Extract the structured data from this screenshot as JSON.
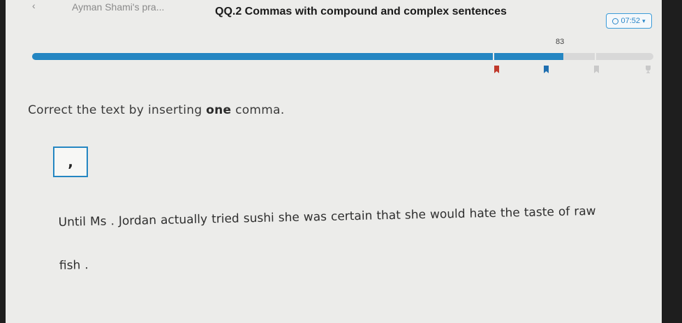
{
  "header": {
    "breadcrumb": "Ayman Shami's pra...",
    "skill_title": "QQ.2 Commas with compound and complex sentences",
    "timer": "07:52"
  },
  "progress": {
    "score_label": "83",
    "fraction": 0.855
  },
  "question": {
    "prompt_before": "Correct the text by inserting ",
    "prompt_emphasis": "one",
    "prompt_after": " comma.",
    "tile_symbol": ",",
    "sentence_line1": [
      "Until",
      "Ms",
      ".",
      "Jordan",
      "actually",
      "tried",
      "sushi",
      "she",
      "was",
      "certain",
      "that",
      "she",
      "would",
      "hate",
      "the",
      "taste",
      "of",
      "raw"
    ],
    "sentence_line2": [
      "fish",
      "."
    ]
  },
  "colors": {
    "accent": "#2486c2",
    "track": "#d8d8d8",
    "flag_red": "#c0392b",
    "flag_blue": "#1f6fb0"
  }
}
